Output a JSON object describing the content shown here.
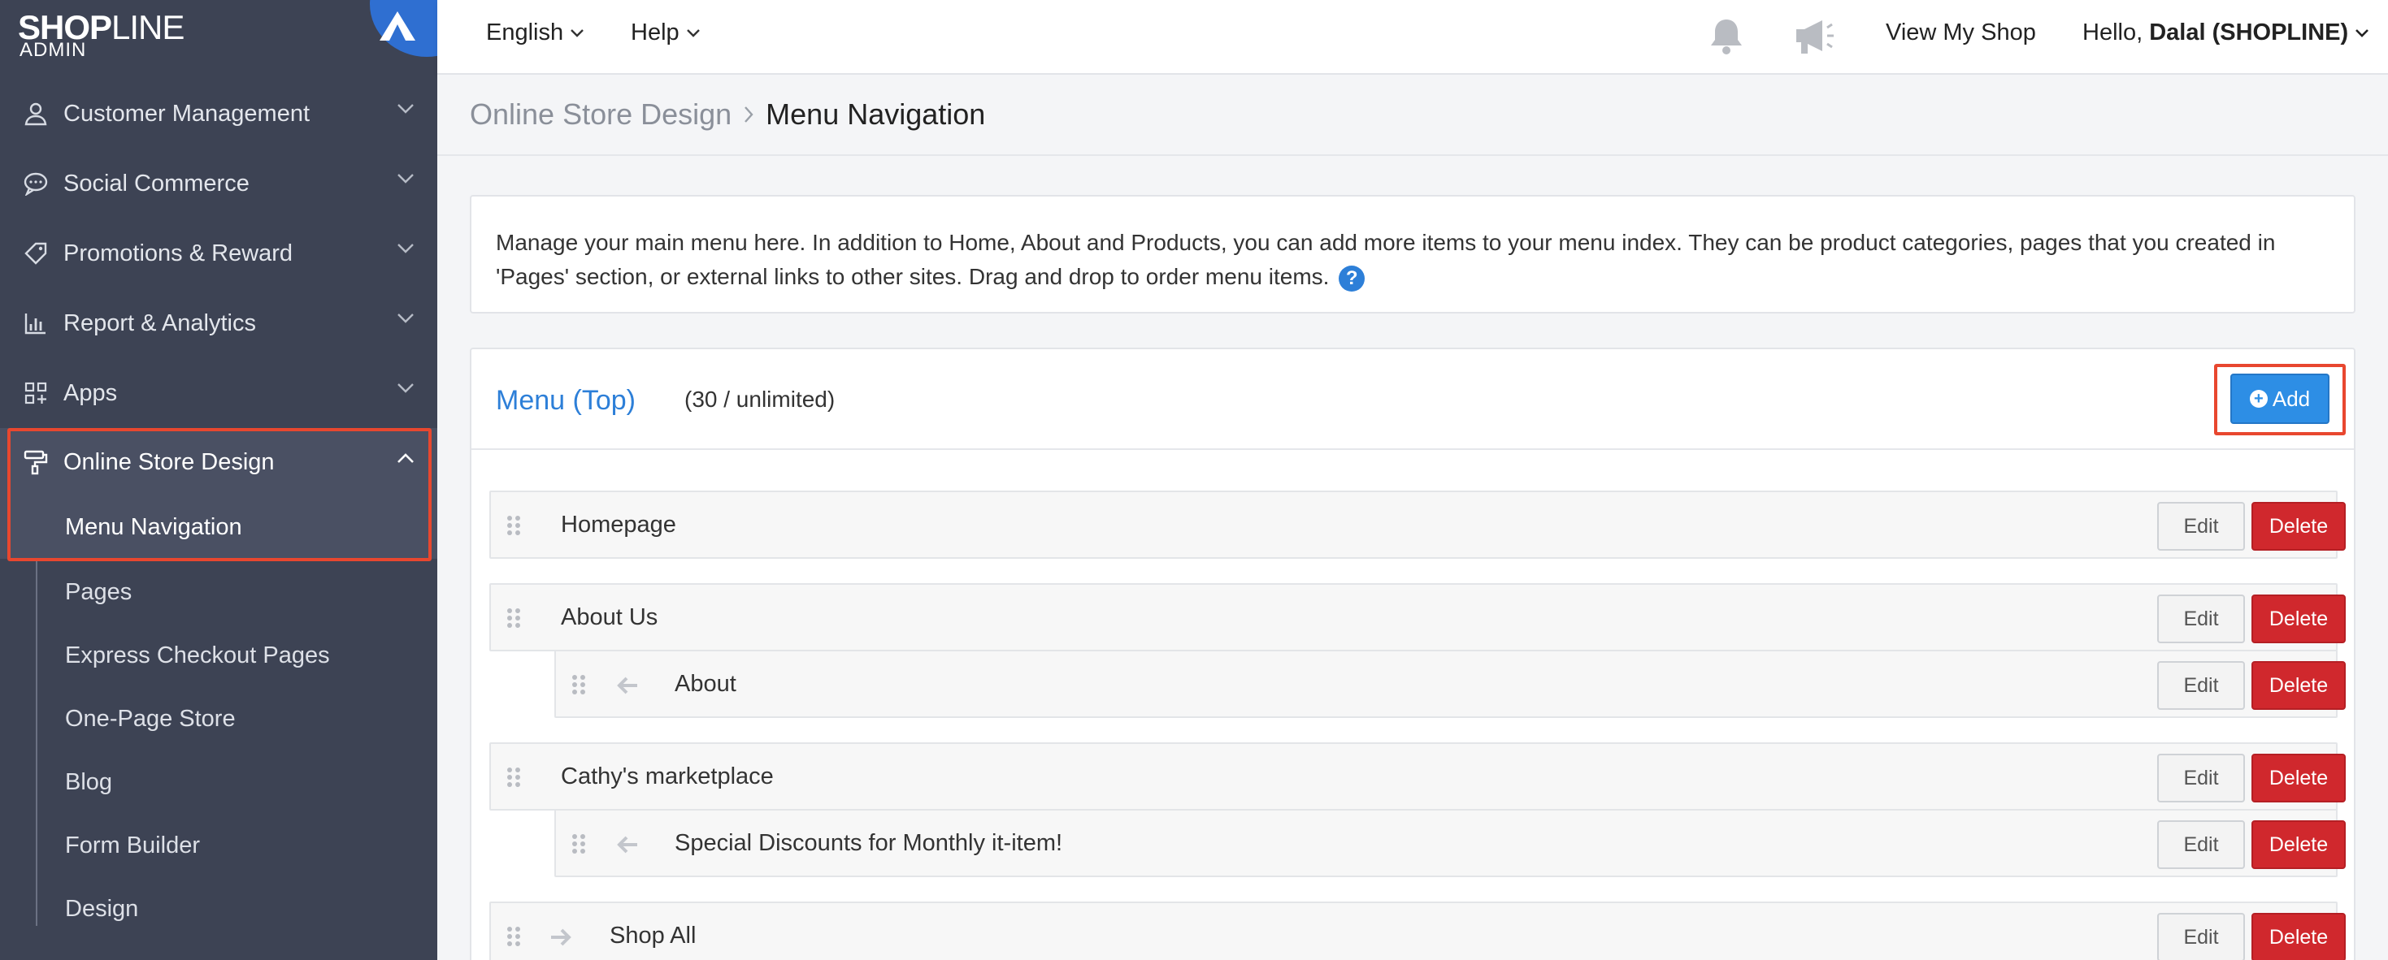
{
  "brand": {
    "name_bold": "SHOP",
    "name_rest": "LINE",
    "subtitle": "ADMIN"
  },
  "sidebar": {
    "items": [
      {
        "label": "Customer Management",
        "icon": "user-icon"
      },
      {
        "label": "Social Commerce",
        "icon": "chat-bubble-icon"
      },
      {
        "label": "Promotions & Reward",
        "icon": "tag-icon"
      },
      {
        "label": "Report & Analytics",
        "icon": "bar-chart-icon"
      },
      {
        "label": "Apps",
        "icon": "apps-grid-icon"
      },
      {
        "label": "Online Store Design",
        "icon": "paint-roller-icon",
        "expanded": true
      }
    ],
    "sub_items": [
      {
        "label": "Menu Navigation",
        "current": true
      },
      {
        "label": "Pages"
      },
      {
        "label": "Express Checkout Pages"
      },
      {
        "label": "One-Page Store"
      },
      {
        "label": "Blog"
      },
      {
        "label": "Form Builder"
      },
      {
        "label": "Design"
      }
    ]
  },
  "topbar": {
    "language": "English",
    "help": "Help",
    "view_shop": "View My Shop",
    "greeting": "Hello,",
    "user": "Dalal (SHOPLINE)"
  },
  "breadcrumb": {
    "parent": "Online Store Design",
    "current": "Menu Navigation"
  },
  "info": {
    "text": "Manage your main menu here. In addition to Home, About and Products, you can add more items to your menu index. They can be product categories, pages that you created in 'Pages' section, or external links to other sites. Drag and drop to order menu items."
  },
  "menu": {
    "title": "Menu (Top)",
    "count": "(30 / unlimited)",
    "add_label": "Add",
    "edit_label": "Edit",
    "delete_label": "Delete",
    "rows": [
      {
        "label": "Homepage",
        "level": 0
      },
      {
        "label": "About Us",
        "level": 0
      },
      {
        "label": "About",
        "level": 1
      },
      {
        "label": "Cathy's marketplace",
        "level": 0
      },
      {
        "label": "Special Discounts for Monthly it-item!",
        "level": 1
      },
      {
        "label": "Shop All",
        "level": 0
      }
    ]
  },
  "colors": {
    "sidebar_bg": "#3d4354",
    "accent": "#2d7fd8",
    "danger": "#d0282d",
    "highlight": "#e8472f"
  }
}
